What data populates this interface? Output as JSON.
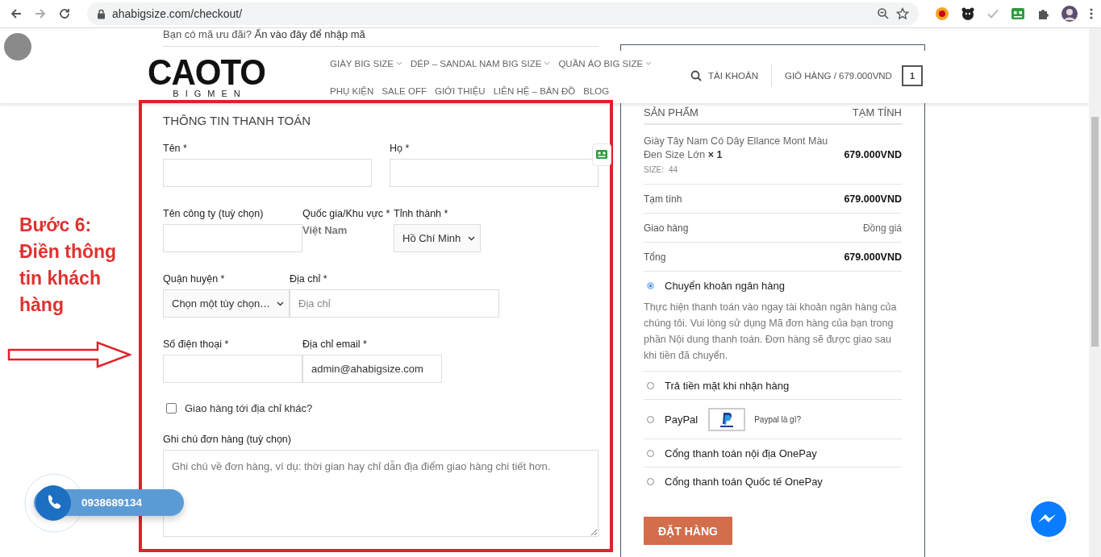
{
  "browser": {
    "url": "ahabigsize.com/checkout/"
  },
  "coupon_notice": {
    "question": "Bạn có mã ưu đãi?",
    "link": "Ấn vào đây để nhập mã"
  },
  "header": {
    "logo": "CAOTO",
    "tagline": "BIGMEN",
    "nav_rows": [
      [
        {
          "label": "GIÀY BIG SIZE",
          "has_dropdown": true
        },
        {
          "label": "DÉP – SANDAL NAM BIG SIZE",
          "has_dropdown": true
        },
        {
          "label": "QUẦN ÁO BIG SIZE",
          "has_dropdown": true
        }
      ],
      [
        {
          "label": "PHỤ KIỆN",
          "has_dropdown": false
        },
        {
          "label": "SALE OFF",
          "has_dropdown": false
        },
        {
          "label": "GIỚI THIỆU",
          "has_dropdown": false
        },
        {
          "label": "LIÊN HỆ – BẢN ĐỒ",
          "has_dropdown": false
        },
        {
          "label": "BLOG",
          "has_dropdown": false
        }
      ]
    ],
    "account": "TÀI KHOẢN",
    "cart": "GIỎ HÀNG / 679.000VND",
    "cart_count": "1"
  },
  "billing": {
    "title": "THÔNG TIN THANH TOÁN",
    "rows": [
      [
        {
          "kind": "input",
          "label": "Tên *"
        },
        {
          "kind": "input",
          "label": "Họ *"
        }
      ],
      [
        {
          "kind": "input",
          "label": "Tên công ty (tuỳ chọn)"
        },
        {
          "kind": "static",
          "label": "Quốc gia/Khu vực *",
          "value": "Việt Nam"
        },
        {
          "kind": "select",
          "label": "Tỉnh thành *",
          "value": "Hồ Chí Minh"
        }
      ],
      [
        {
          "kind": "select",
          "label": "Quận huyện *",
          "value": "Chọn một tùy chọn…"
        },
        {
          "kind": "input",
          "label": "Địa chỉ *",
          "placeholder": "Địa chỉ"
        }
      ],
      [
        {
          "kind": "input",
          "label": "Số điện thoại *"
        },
        {
          "kind": "input",
          "label": "Địa chỉ email *",
          "value": "admin@ahabigsize.com"
        }
      ]
    ],
    "ship_elsewhere": {
      "label": "Giao hàng tới địa chỉ khác?",
      "checked": false
    },
    "notes": {
      "label": "Ghi chú đơn hàng (tuỳ chọn)",
      "placeholder": "Ghi chú về đơn hàng, ví dụ: thời gian hay chỉ dẫn địa điểm giao hàng chi tiết hơn."
    }
  },
  "order": {
    "columns": [
      "SẢN PHẨM",
      "TẠM TÍNH"
    ],
    "items": [
      {
        "name": "Giày Tây Nam Có Dây Ellance Mont Màu Đen Size Lớn",
        "quantity": "× 1",
        "meta_label": "SIZE:",
        "meta_value": "44",
        "price": "679.000VND"
      }
    ],
    "totals": [
      {
        "label": "Tạm tính",
        "value": "679.000VND",
        "kind": "amount"
      },
      {
        "label": "Giao hàng",
        "value": "Đồng giá",
        "kind": "note"
      },
      {
        "label": "Tổng",
        "value": "679.000VND",
        "kind": "amount"
      }
    ],
    "payment_methods": [
      {
        "label": "Chuyển khoản ngân hàng",
        "selected": true,
        "description": "Thực hiện thanh toán vào ngay tài khoản ngân hàng của chúng tôi. Vui lòng sử dụng Mã đơn hàng của bạn trong phần Nội dung thanh toán. Đơn hàng sẽ được giao sau khi tiền đã chuyển."
      },
      {
        "label": "Trả tiền mặt khi nhận hàng",
        "selected": false
      },
      {
        "label": "PayPal",
        "selected": false,
        "info_link": "Paypal là gì?"
      },
      {
        "label": "Cổng thanh toán nội địa OnePay",
        "selected": false
      },
      {
        "label": "Cổng thanh toán Quốc tế OnePay",
        "selected": false
      }
    ],
    "place_order": "ĐẶT HÀNG"
  },
  "annotation": {
    "text": "Bước 6: Điền thông tin khách hàng"
  },
  "call_widget": {
    "phone": "0938689134"
  }
}
